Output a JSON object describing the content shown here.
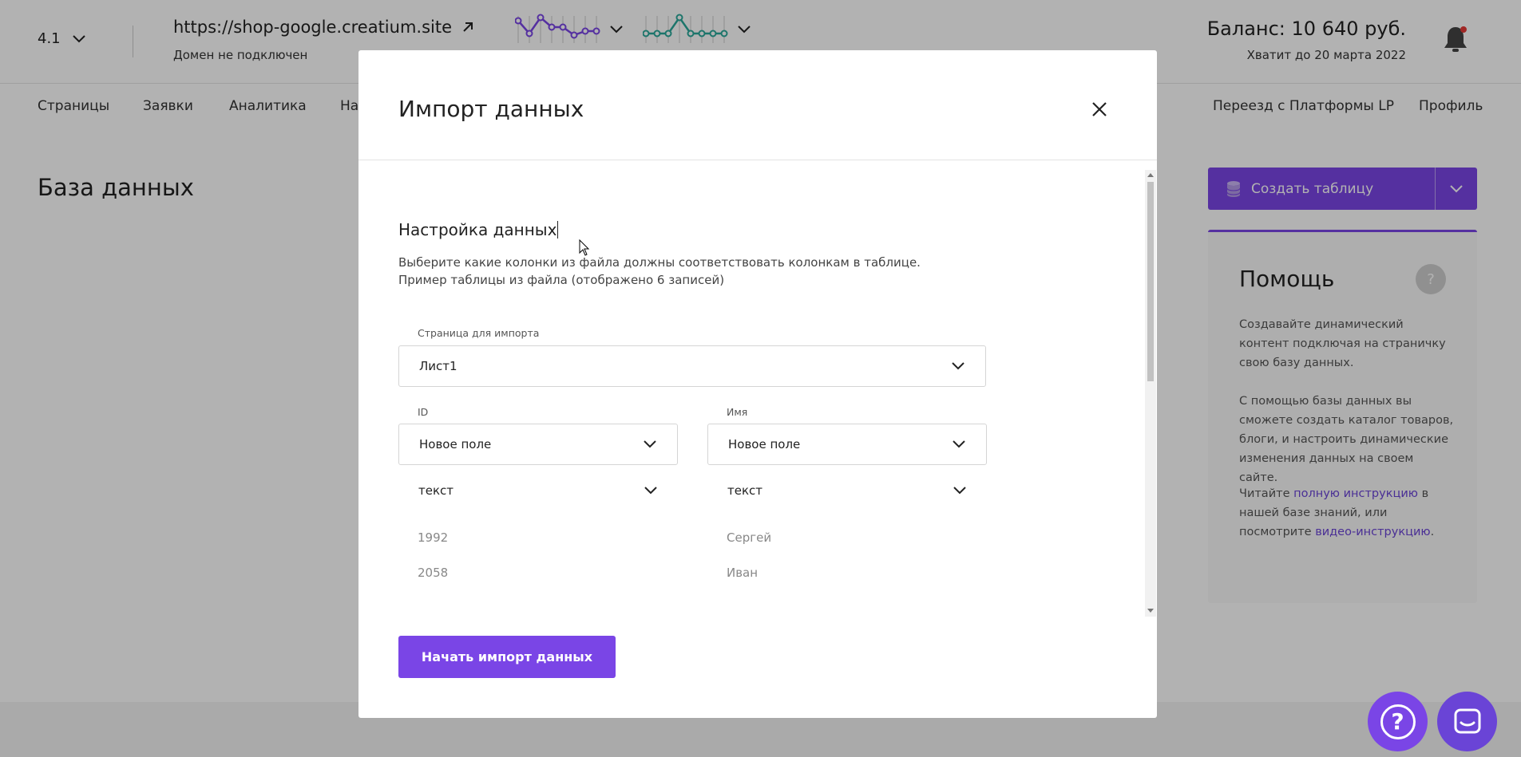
{
  "topbar": {
    "version": "4.1",
    "site_url": "https://shop-google.creatium.site",
    "site_status": "Домен не подключен",
    "balance": "Баланс: 10 640 руб.",
    "balance_note": "Хватит до 20 марта 2022"
  },
  "nav": {
    "items": [
      "Страницы",
      "Заявки",
      "Аналитика",
      "На"
    ],
    "right_items": [
      "Переезд с Платформы LP",
      "Профиль"
    ]
  },
  "page": {
    "title": "База данных",
    "create_button": "Создать таблицу"
  },
  "help": {
    "title": "Помощь",
    "question_mark": "?",
    "p1": "Создавайте динамический контент подключая на страничку свою базу данных.",
    "p2": "С помощью базы данных вы сможете создать каталог товаров, блоги, и настроить динамические изменения данных на своем сайте.",
    "p3_before": "Читайте ",
    "p3_link1": "полную инструкцию",
    "p3_middle": " в нашей базе знаний, или посмотрите ",
    "p3_link2": "видео-инструкцию",
    "p3_after": "."
  },
  "modal": {
    "title": "Импорт данных",
    "section_title": "Настройка данных",
    "desc_line1": "Выберите какие колонки из файла должны соответствовать колонкам в таблице.",
    "desc_line2": "Пример таблицы из файла (отображено 6 записей)",
    "sheet_label": "Страница для импорта",
    "sheet_value": "Лист1",
    "columns": [
      {
        "label": "ID",
        "field": "Новое поле",
        "type": "текст",
        "rows": [
          "1992",
          "2058"
        ]
      },
      {
        "label": "Имя",
        "field": "Новое поле",
        "type": "текст",
        "rows": [
          "Сергей",
          "Иван"
        ]
      }
    ],
    "import_button": "Начать импорт данных"
  },
  "colors": {
    "accent": "#7a45e6",
    "spark_purple": "#7a45e6",
    "spark_teal": "#2aa89a",
    "overlay": "rgba(0,0,0,0.3)"
  }
}
